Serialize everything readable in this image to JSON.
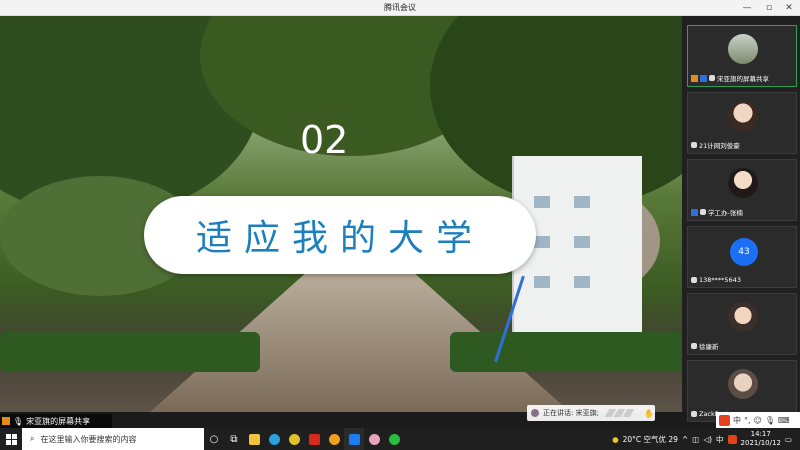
{
  "window": {
    "title": "腾讯会议",
    "min_glyph": "—",
    "max_glyph": "▫",
    "close_glyph": "✕"
  },
  "slide": {
    "number": "02",
    "heading": "适应我的大学"
  },
  "share_bar": {
    "label": "宋亚旗的屏幕共享"
  },
  "speaking": {
    "label": "正在讲话: 宋亚旗;"
  },
  "participants": [
    {
      "name": "宋亚旗的屏幕共享"
    },
    {
      "name": "21计网刘俊豪"
    },
    {
      "name": "学工办-张楠"
    },
    {
      "name": "138****5643",
      "avatar_text": "43"
    },
    {
      "name": "徐康新"
    },
    {
      "name": "ZackFoster"
    }
  ],
  "taskbar": {
    "search_placeholder": "在这里输入你要搜索的内容",
    "weather": "20°C 空气优 29",
    "ime_lang": "中",
    "time": "14:17",
    "date": "2021/10/12"
  },
  "ime_bar": {
    "mode": "中"
  },
  "colors": {
    "accent": "#1e7fbf",
    "active_border": "#2c9e58",
    "avatar_blue": "#1b6ff5"
  }
}
